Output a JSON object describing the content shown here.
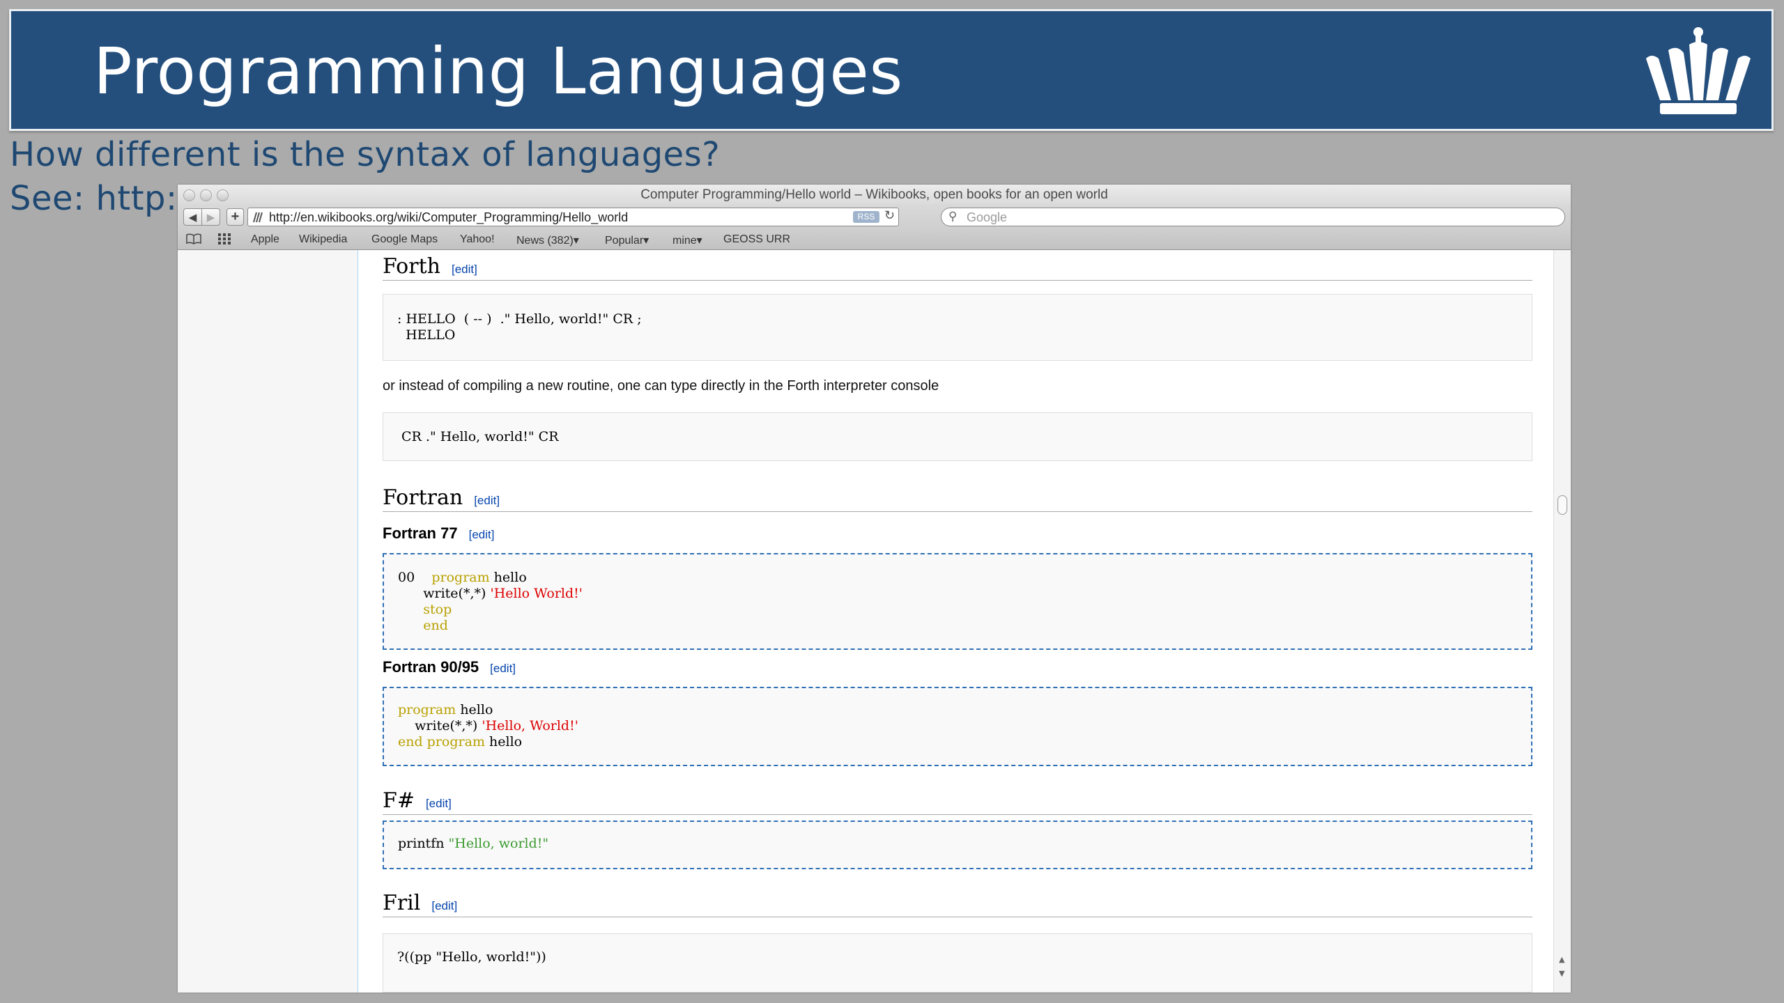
{
  "slide": {
    "title": "Programming Languages",
    "subtitle_line1": "How different is the syntax of languages?",
    "subtitle_line2": "See: http:/"
  },
  "browser": {
    "window_title": "Computer Programming/Hello world – Wikibooks, open books for an open world",
    "url": "http://en.wikibooks.org/wiki/Computer_Programming/Hello_world",
    "rss_label": "RSS",
    "search_placeholder": "Google",
    "bookmarks": [
      "Apple",
      "Wikipedia",
      "Google Maps",
      "Yahoo!",
      "News (382)▾",
      "Popular▾",
      "mine▾",
      "GEOSS URR"
    ]
  },
  "article": {
    "edit_label": "[edit]",
    "forth": {
      "heading": "Forth",
      "code_line1": ": HELLO  ( -- )  .\" Hello, world!\" CR ;",
      "code_line2": "  HELLO",
      "note": "or instead of compiling a new routine, one can type directly in the Forth interpreter console",
      "code2": " CR .\" Hello, world!\" CR"
    },
    "fortran": {
      "heading": "Fortran",
      "f77": {
        "heading": "Fortran 77",
        "label_00": "00",
        "kw_program": "program",
        "name": " hello",
        "write": "write(*,*) ",
        "str": "'Hello World!'",
        "stop": "stop",
        "end": "end"
      },
      "f90": {
        "heading": "Fortran 90/95",
        "kw_program": "program",
        "name": " hello",
        "write": "    write(*,*) ",
        "str": "'Hello, World!'",
        "end_program": "end program",
        "end_name": " hello"
      }
    },
    "fsharp": {
      "heading": "F#",
      "fn": "printfn ",
      "str": "\"Hello, world!\""
    },
    "fril": {
      "heading": "Fril",
      "code": "?((pp \"Hello, world!\"))"
    }
  }
}
